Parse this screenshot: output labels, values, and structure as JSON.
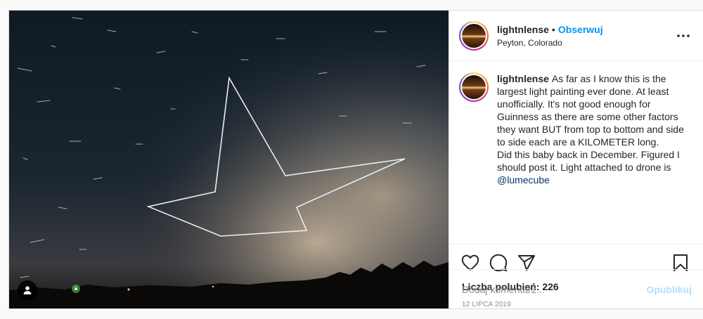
{
  "post": {
    "username": "lightnlense",
    "follow_label": "Obserwuj",
    "separator": "•",
    "location": "Peyton, Colorado",
    "more_icon": "more-horizontal-icon",
    "tag_icon": "user-tag-icon"
  },
  "caption": {
    "username": "lightnlense",
    "line1": "As far as I know this is the largest light painting ever done. At least unofficially. It's not good enough for Guinness as there are some other factors they want BUT from top to bottom and side to side each are a KILOMETER long.",
    "line2": "Did this baby back in December. Figured I should post it. Light attached to drone is",
    "mention": "@lumecube"
  },
  "actions": {
    "icons": [
      "heart-icon",
      "comment-icon",
      "share-icon",
      "bookmark-icon"
    ]
  },
  "likes": {
    "text": "Liczba polubień: 226"
  },
  "date": "12 LIPCA 2019",
  "comment": {
    "placeholder": "Dodaj komentarz...",
    "publish_label": "Opublikuj"
  },
  "colors": {
    "accent": "#0095f6",
    "publish_disabled": "#b2dffc",
    "muted": "#8e8e8e",
    "border": "#dbdbdb"
  }
}
